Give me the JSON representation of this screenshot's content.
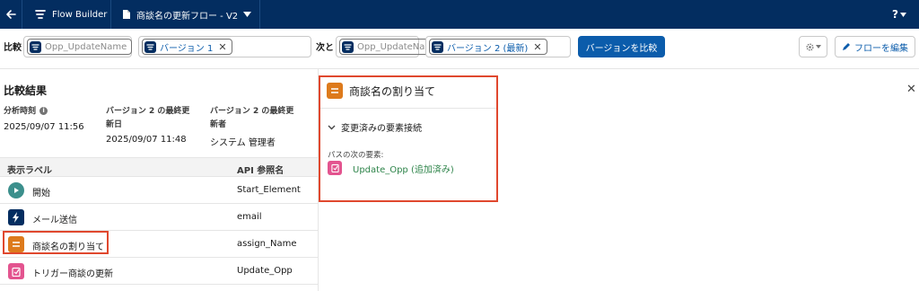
{
  "topbar": {
    "app_name": "Flow Builder",
    "flow_title": "商談名の更新フロー - V2",
    "help_label": "?"
  },
  "compare": {
    "left_label": "比較",
    "left_flow_placeholder": "Opp_UpdateName",
    "left_version": "バージョン 1",
    "right_label": "次と",
    "right_flow_placeholder": "Opp_UpdateName",
    "right_version": "バージョン 2 (最新)",
    "compare_button": "バージョンを比較",
    "edit_button": "フローを編集"
  },
  "results": {
    "title": "比較結果",
    "meta": [
      {
        "label": "分析時刻",
        "value": "2025/09/07 11:56"
      },
      {
        "label_line1": "バージョン 2 の最終更",
        "label_line2": "新日",
        "value": "2025/09/07 11:48"
      },
      {
        "label_line1": "バージョン 2 の最終更",
        "label_line2": "新者",
        "value": "システム 管理者"
      }
    ],
    "table": {
      "headers": [
        "表示ラベル",
        "API 参照名"
      ],
      "rows": [
        {
          "label": "開始",
          "api": "Start_Element",
          "icon": "play-icon",
          "color": "#3b8f8c"
        },
        {
          "label": "メール送信",
          "api": "email",
          "icon": "lightning-icon",
          "color": "#032d60"
        },
        {
          "label": "商談名の割り当て",
          "api": "assign_Name",
          "icon": "assignment-icon",
          "color": "#dd7a1c"
        },
        {
          "label": "トリガー商談の更新",
          "api": "Update_Opp",
          "icon": "update-record-icon",
          "color": "#e3548f"
        }
      ]
    }
  },
  "detail": {
    "title": "商談名の割り当て",
    "section": "変更済みの要素接続",
    "path_label": "パスの次の要素:",
    "path_item": "Update_Opp (追加済み)"
  },
  "colors": {
    "topbar": "#032d60",
    "brand_blue": "#0b5cab",
    "highlight": "#e0482e",
    "added_green": "#2e844a"
  }
}
